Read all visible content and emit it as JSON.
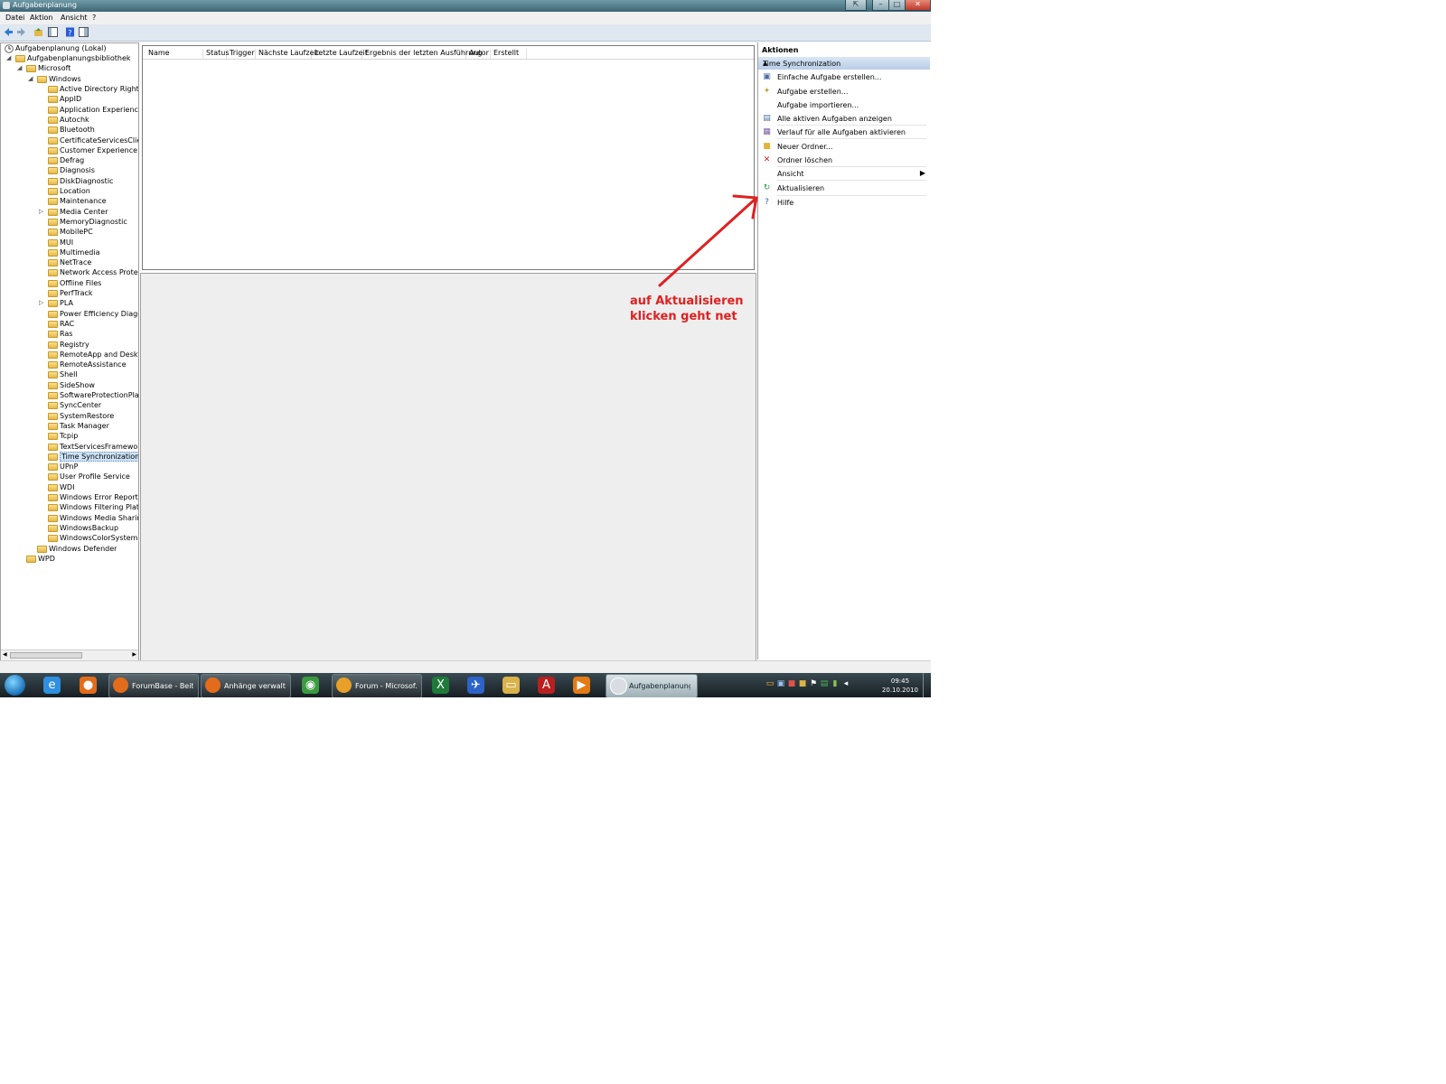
{
  "window": {
    "title": "Aufgabenplanung",
    "buttons": [
      "⇱",
      "–",
      "□",
      "✕"
    ]
  },
  "menu": [
    "Datei",
    "Aktion",
    "Ansicht",
    "?"
  ],
  "toolbar": [
    "back-arrow-icon",
    "forward-arrow-icon",
    "up-folder-icon",
    "show-hide-tree-icon",
    "help-icon",
    "console-icon"
  ],
  "tree": {
    "root": "Aufgabenplanung (Lokal)",
    "library": "Aufgabenplanungsbibliothek",
    "microsoft": "Microsoft",
    "windows": "Windows",
    "items": [
      "Active Directory Rights M",
      "AppID",
      "Application Experience",
      "Autochk",
      "Bluetooth",
      "CertificateServicesClient",
      "Customer Experience Imp",
      "Defrag",
      "Diagnosis",
      "DiskDiagnostic",
      "Location",
      "Maintenance",
      "Media Center",
      "MemoryDiagnostic",
      "MobilePC",
      "MUI",
      "Multimedia",
      "NetTrace",
      "Network Access Protection",
      "Offline Files",
      "PerfTrack",
      "PLA",
      "Power Efficiency Diagnos",
      "RAC",
      "Ras",
      "Registry",
      "RemoteApp and Desktop",
      "RemoteAssistance",
      "Shell",
      "SideShow",
      "SoftwareProtectionPlatfo",
      "SyncCenter",
      "SystemRestore",
      "Task Manager",
      "Tcpip",
      "TextServicesFramework",
      "Time Synchronization",
      "UPnP",
      "User Profile Service",
      "WDI",
      "Windows Error Reporting",
      "Windows Filtering Platfo",
      "Windows Media Sharing",
      "WindowsBackup",
      "WindowsColorSystem"
    ],
    "expandable": [
      "Media Center",
      "PLA"
    ],
    "selected": "Time Synchronization",
    "defender": "Windows Defender",
    "wpd": "WPD"
  },
  "columns": [
    "Name",
    "Status",
    "Trigger",
    "Nächste Laufzeit",
    "Letzte Laufzeit",
    "Ergebnis der letzten Ausführung",
    "Autor",
    "Erstellt"
  ],
  "actions": {
    "header": "Aktionen",
    "section": "Time Synchronization",
    "items": [
      {
        "label": "Einfache Aufgabe erstellen...",
        "icon": "wizard-icon",
        "glyph": "▣",
        "color": "#4a6fa5"
      },
      {
        "label": "Aufgabe erstellen...",
        "icon": "create-task-icon",
        "glyph": "✦",
        "color": "#c9a22c"
      },
      {
        "label": "Aufgabe importieren...",
        "icon": "",
        "glyph": "",
        "color": "#000000"
      },
      {
        "label": "Alle aktiven Aufgaben anzeigen",
        "icon": "running-tasks-icon",
        "glyph": "▤",
        "color": "#4a6fa5"
      },
      {
        "label": "Verlauf für alle Aufgaben aktivieren",
        "icon": "history-icon",
        "glyph": "▦",
        "color": "#7a5c9e"
      },
      {
        "label": "Neuer Ordner...",
        "icon": "new-folder-icon",
        "glyph": "■",
        "color": "#e2b33c"
      },
      {
        "label": "Ordner löschen",
        "icon": "delete-icon",
        "glyph": "✕",
        "color": "#d42020"
      },
      {
        "label": "Ansicht",
        "icon": "",
        "glyph": "",
        "color": "#000000",
        "submenu": "▶"
      },
      {
        "label": "Aktualisieren",
        "icon": "refresh-icon",
        "glyph": "↻",
        "color": "#2e9a3a"
      },
      {
        "label": "Hilfe",
        "icon": "help-icon",
        "glyph": "?",
        "color": "#2a5bd7"
      }
    ]
  },
  "taskbar": {
    "pinned": [
      {
        "name": "internet-explorer-icon",
        "glyph": "e",
        "color": "#2f8fe0"
      },
      {
        "name": "firefox-icon",
        "glyph": "●",
        "color": "#e36c1a"
      }
    ],
    "tasks": [
      {
        "label": "ForumBase - Beitr...",
        "icon": "firefox-icon",
        "color": "#e36c1a"
      },
      {
        "label": "Anhänge verwalte...",
        "icon": "firefox-icon",
        "color": "#e36c1a"
      }
    ],
    "pinned2": [
      {
        "name": "chrome-icon",
        "glyph": "◉",
        "color": "#3a9b3f"
      }
    ],
    "tasks2": [
      {
        "label": "Forum - Microsof...",
        "icon": "outlook-icon",
        "color": "#e8a028"
      }
    ],
    "pinned3": [
      {
        "name": "excel-icon",
        "glyph": "X",
        "color": "#1f7a3a"
      },
      {
        "name": "network-tool-icon",
        "glyph": "✈",
        "color": "#2d63c8"
      },
      {
        "name": "explorer-folder-icon",
        "glyph": "▭",
        "color": "#d9b24a"
      },
      {
        "name": "acrobat-icon",
        "glyph": "A",
        "color": "#b81f1f"
      },
      {
        "name": "media-player-icon",
        "glyph": "▶",
        "color": "#e27b15"
      }
    ],
    "active_task": {
      "label": "Aufgabenplanung",
      "icon": "task-scheduler-icon",
      "color": "#d7dde0"
    },
    "tray": [
      "message-icon",
      "network-status-icon",
      "windows-flag-icon",
      "security-icon",
      "flag-icon",
      "device-icon",
      "wifi-icon",
      "volume-icon"
    ],
    "time": "09:45",
    "date": "20.10.2010"
  },
  "annotation": {
    "line1": "auf Aktualisieren",
    "line2": "klicken geht net",
    "color": "#e02020"
  }
}
